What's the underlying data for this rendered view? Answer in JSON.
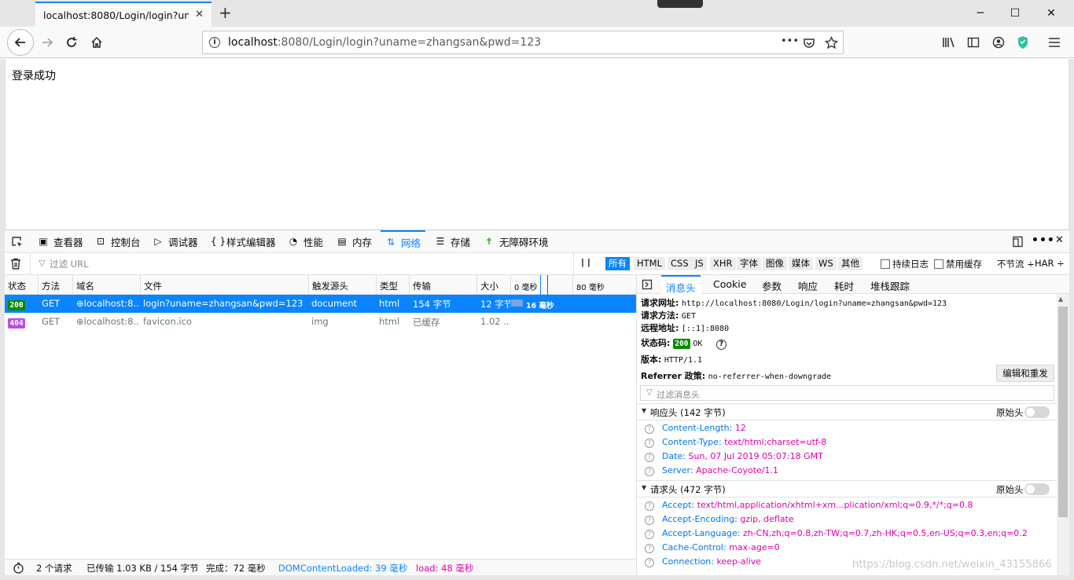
{
  "browser": {
    "tab_title": "localhost:8080/Login/login?uname=zhangsan&pwd=123",
    "tab_close": "✕",
    "new_tab": "+",
    "url_host": "localhost",
    "url_rest": ":8080/Login/login?uname=zhangsan&pwd=123",
    "url_more": "•••",
    "window_minimize": "─",
    "window_maximize": "☐",
    "window_close": "✕"
  },
  "page": {
    "text": "登录成功"
  },
  "devtools": {
    "tabs": [
      {
        "label": "查看器",
        "icon": "inspector-icon"
      },
      {
        "label": "控制台",
        "icon": "console-icon"
      },
      {
        "label": "调试器",
        "icon": "debugger-icon"
      },
      {
        "label": "样式编辑器",
        "icon": "style-editor-icon"
      },
      {
        "label": "性能",
        "icon": "performance-icon"
      },
      {
        "label": "内存",
        "icon": "memory-icon"
      },
      {
        "label": "网络",
        "icon": "network-icon"
      },
      {
        "label": "存储",
        "icon": "storage-icon"
      },
      {
        "label": "无障碍环境",
        "icon": "accessibility-icon"
      }
    ],
    "active_tab": "网络",
    "filter_placeholder": "过滤 URL",
    "pause": "| |",
    "type_filters": [
      "所有",
      "HTML",
      "CSS",
      "JS",
      "XHR",
      "字体",
      "图像",
      "媒体",
      "WS",
      "其他"
    ],
    "persist_logs": "持续日志",
    "disable_cache": "禁用缓存",
    "throttle": "不节流 ÷",
    "har": "HAR ÷",
    "columns": [
      "状态",
      "方法",
      "域名",
      "文件",
      "触发源头",
      "类型",
      "传输",
      "大小"
    ],
    "timeline_ticks": [
      "0 毫秒",
      "80 毫秒"
    ],
    "requests": [
      {
        "status": "200",
        "method": "GET",
        "domain": "localhost:8...",
        "file": "login?uname=zhangsan&pwd=123",
        "cause": "document",
        "type": "html",
        "transferred": "154 字节",
        "size": "12 字节",
        "timing": "16 毫秒",
        "status_color": "#058b00"
      },
      {
        "status": "404",
        "method": "GET",
        "domain": "localhost:8...",
        "file": "favicon.ico",
        "cause": "img",
        "type": "html",
        "transferred": "已缓存",
        "size": "1.02 ...",
        "timing": "",
        "status_color": "#b84de6"
      }
    ],
    "summary": {
      "requests": "2 个请求",
      "transferred": "已传输 1.03 KB / 154 字节",
      "finish": "完成：72 毫秒",
      "dom_content_loaded": "DOMContentLoaded: 39 毫秒",
      "load": "load: 48 毫秒"
    },
    "details": {
      "tabs": [
        "消息头",
        "Cookie",
        "参数",
        "响应",
        "耗时",
        "堆栈跟踪"
      ],
      "active_tab": "消息头",
      "request_url_label": "请求网址:",
      "request_url": "http://localhost:8080/Login/login?uname=zhangsan&pwd=123",
      "method_label": "请求方法:",
      "method": "GET",
      "remote_label": "远程地址:",
      "remote": "[::1]:8080",
      "status_label": "状态码:",
      "status_code": "200",
      "status_text": "OK",
      "version_label": "版本:",
      "version": "HTTP/1.1",
      "referrer_label": "Referrer 政策:",
      "referrer": "no-referrer-when-downgrade",
      "resend_button": "编辑和重发",
      "headers_filter_placeholder": "过滤消息头",
      "response_headers_title": "响应头 (142 字节)",
      "raw_headers": "原始头",
      "response_headers": [
        {
          "name": "Content-Length:",
          "value": "12"
        },
        {
          "name": "Content-Type:",
          "value": "text/html;charset=utf-8"
        },
        {
          "name": "Date:",
          "value": "Sun, 07 Jul 2019 05:07:18 GMT"
        },
        {
          "name": "Server:",
          "value": "Apache-Coyote/1.1"
        }
      ],
      "request_headers_title": "请求头 (472 字节)",
      "request_headers": [
        {
          "name": "Accept:",
          "value": "text/html,application/xhtml+xm...plication/xml;q=0.9,*/*;q=0.8"
        },
        {
          "name": "Accept-Encoding:",
          "value": "gzip, deflate"
        },
        {
          "name": "Accept-Language:",
          "value": "zh-CN,zh;q=0.8,zh-TW;q=0.7,zh-HK;q=0.5,en-US;q=0.3,en;q=0.2"
        },
        {
          "name": "Cache-Control:",
          "value": "max-age=0"
        },
        {
          "name": "Connection:",
          "value": "keep-alive"
        }
      ]
    }
  },
  "watermark": "https://blog.csdn.net/weixin_43155866"
}
